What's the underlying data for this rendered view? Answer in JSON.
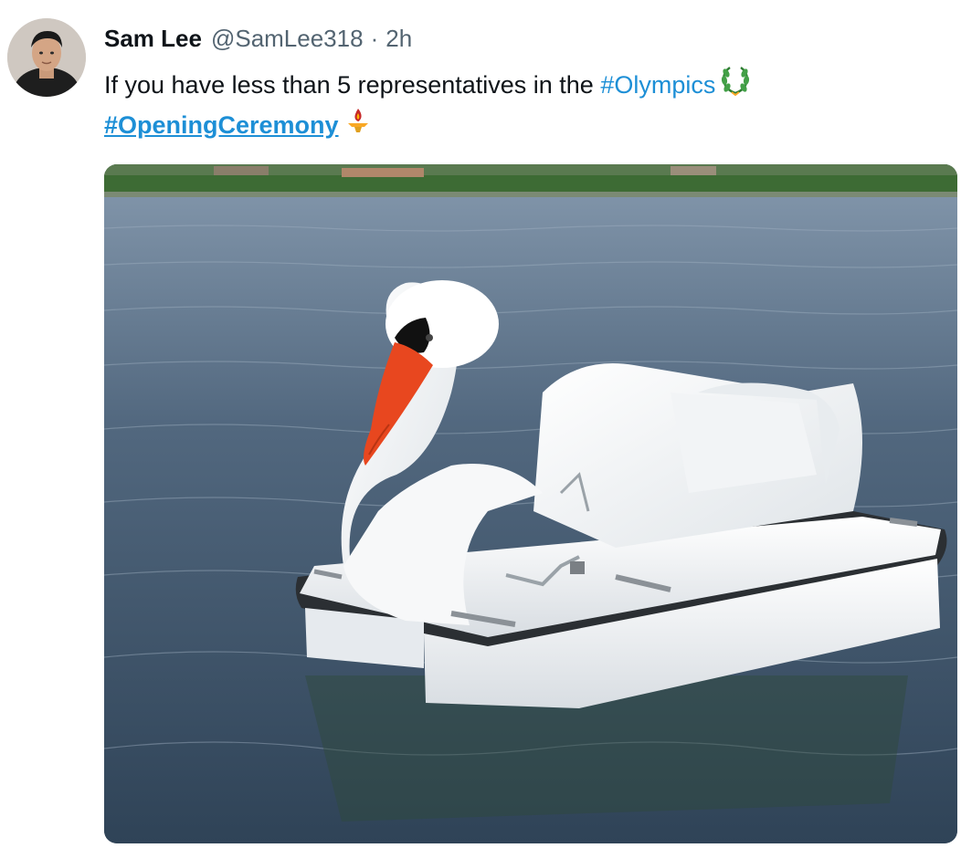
{
  "tweet": {
    "author_name": "Sam Lee",
    "author_handle": "@SamLee318",
    "separator": "·",
    "time": "2h",
    "text_line1": "If you have less than 5 representatives in the ",
    "hashtag_olympics": "#Olympics",
    "hashtag_opening": "#OpeningCeremony",
    "emoji_1": "laurel-wreath",
    "emoji_2": "olympic-torch"
  },
  "colors": {
    "hashtag": "#1d8fd6",
    "handle": "#536471",
    "text": "#0f1419"
  },
  "media": {
    "description_icon": "photo"
  }
}
